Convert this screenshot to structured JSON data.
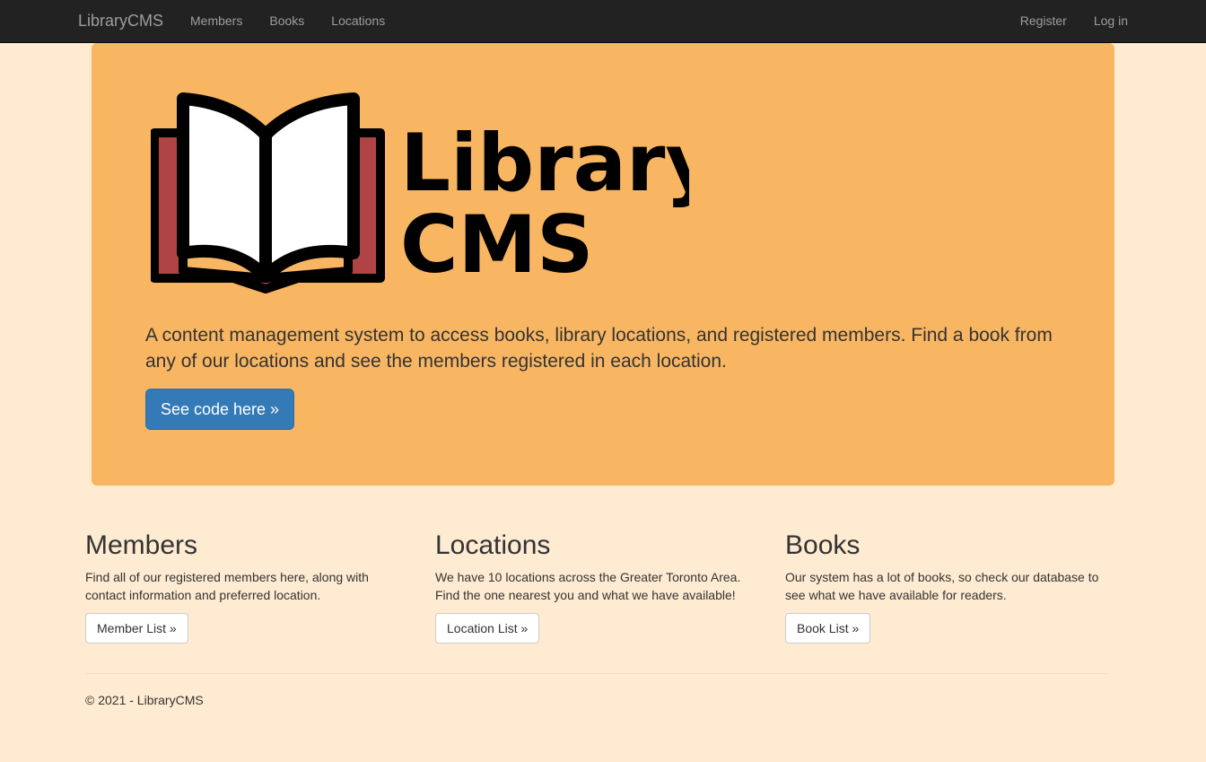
{
  "navbar": {
    "brand": "LibraryCMS",
    "links": [
      "Members",
      "Books",
      "Locations"
    ],
    "register": "Register",
    "login": "Log in"
  },
  "hero": {
    "logo_text_line1": "Library",
    "logo_text_line2": "CMS",
    "lead": "A content management system to access books, library locations, and registered members. Find a book from any of our locations and see the members registered in each location.",
    "button": "See code here »"
  },
  "sections": [
    {
      "title": "Members",
      "text": "Find all of our registered members here, along with contact information and preferred location.",
      "button": "Member List »"
    },
    {
      "title": "Locations",
      "text": "We have 10 locations across the Greater Toronto Area. Find the one nearest you and what we have available!",
      "button": "Location List »"
    },
    {
      "title": "Books",
      "text": "Our system has a lot of books, so check our database to see what we have available for readers.",
      "button": "Book List »"
    }
  ],
  "footer": "© 2021 - LibraryCMS",
  "colors": {
    "background": "#feebd1",
    "hero": "#f9b662",
    "navbar": "#222222",
    "primary": "#337ab7",
    "book_cover": "#b04444"
  }
}
